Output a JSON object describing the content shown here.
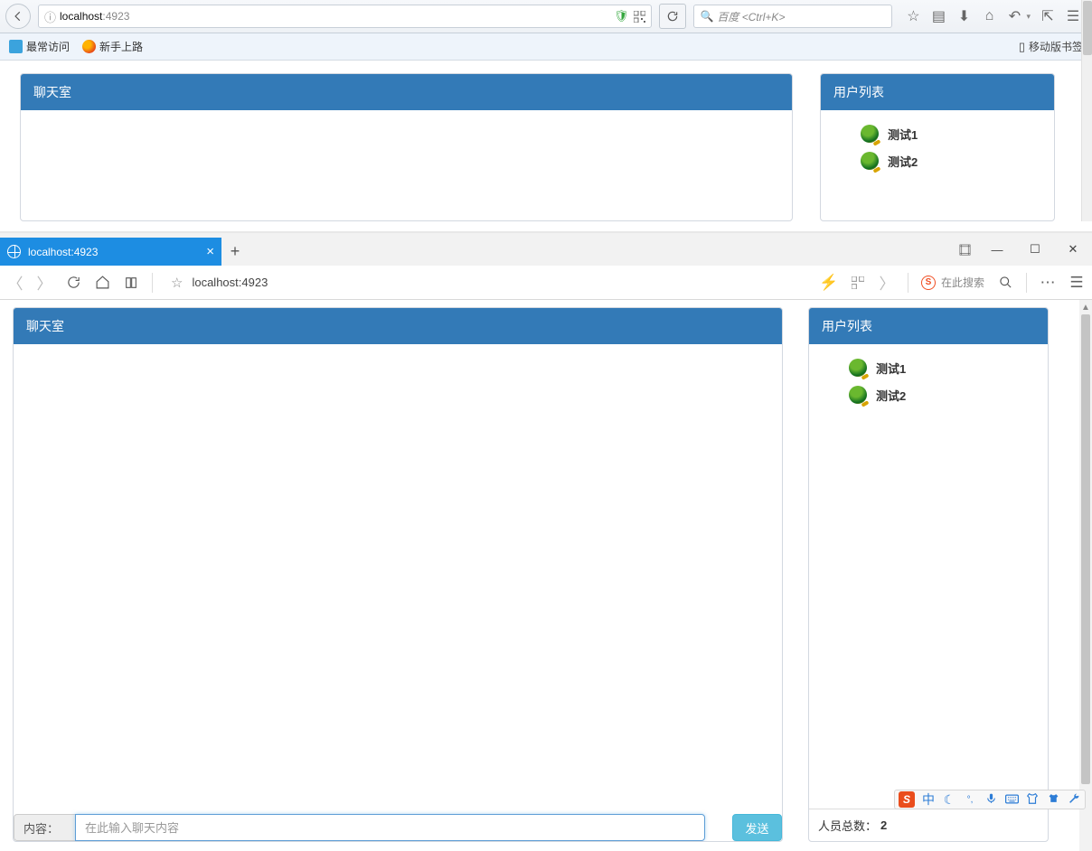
{
  "browser1": {
    "url_host": "localhost",
    "url_port": ":4923",
    "search_placeholder": "百度 <Ctrl+K>",
    "bookmarks": {
      "most_visited": "最常访问",
      "getting_started": "新手上路",
      "mobile": "移动版书签"
    }
  },
  "browser2": {
    "tab_title": "localhost:4923",
    "url": "localhost:4923",
    "search_placeholder": "在此搜索"
  },
  "app": {
    "chat_title": "聊天室",
    "users_title": "用户列表",
    "users": [
      {
        "name": "测试1"
      },
      {
        "name": "测试2"
      }
    ],
    "content_label": "内容：",
    "input_placeholder": "在此输入聊天内容",
    "send_label": "发送",
    "total_label": "人员总数：",
    "total_count": "2"
  },
  "ime": {
    "logo": "S",
    "lang": "中"
  }
}
